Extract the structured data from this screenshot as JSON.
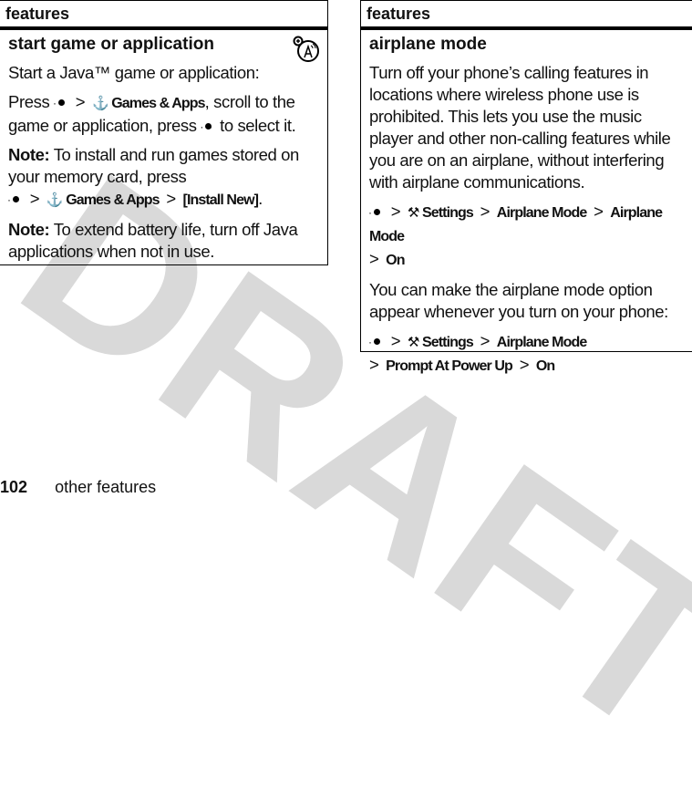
{
  "watermark": "DRAFT",
  "left_box": {
    "header": "features",
    "title": "start game or application",
    "intro": "Start a Java™ game or application:",
    "steps": {
      "press": "Press",
      "menu1": "Games & Apps",
      "rest1": ", scroll to the game or application, press",
      "rest2": "to select it."
    },
    "note1": {
      "label": "Note:",
      "text": "To install and run games stored on your memory card, press",
      "path1": "Games & Apps",
      "path2": "[Install New]"
    },
    "note2": {
      "label": "Note:",
      "text": "To extend battery life, turn off Java applications when not in use."
    }
  },
  "right_box": {
    "header": "features",
    "title": "airplane mode",
    "intro": "Turn off your phone’s calling features in locations where wireless phone use is prohibited. This lets you use the music player and other non-calling features while you are on an airplane, without interfering with airplane communications.",
    "path1": [
      "Settings",
      "Airplane Mode",
      "Airplane Mode",
      "On"
    ],
    "text2": "You can make the airplane mode option appear whenever you turn on your phone:",
    "path2": [
      "Settings",
      "Airplane Mode",
      "Prompt At Power Up",
      "On"
    ]
  },
  "footer": {
    "page_number": "102",
    "section": "other features"
  },
  "symbols": {
    "sep": ">",
    "games_icon": "⚓",
    "settings_icon": "⚒"
  }
}
